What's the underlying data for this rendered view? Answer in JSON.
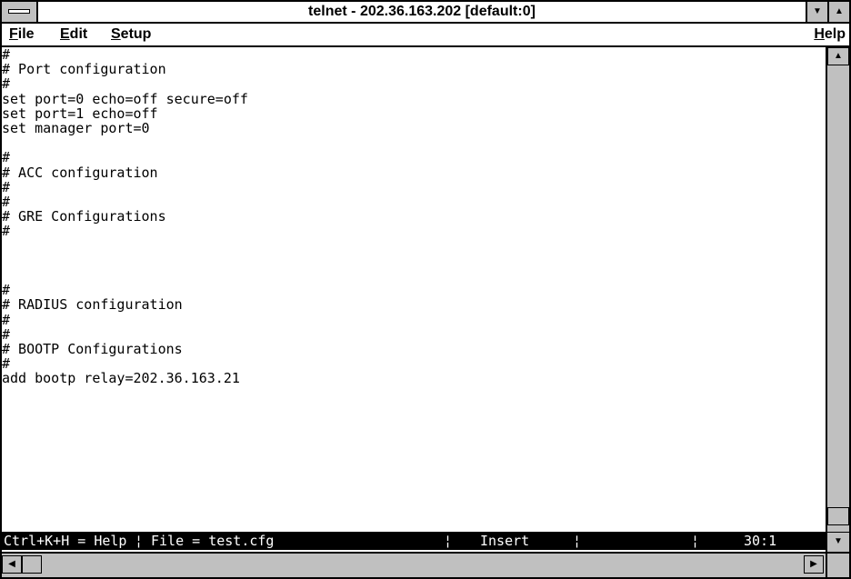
{
  "window": {
    "title": "telnet - 202.36.163.202 [default:0]",
    "system_menu_icon": "system-menu-icon",
    "minimize_icon": "▼",
    "maximize_icon": "▲"
  },
  "menubar": {
    "items": [
      {
        "label": "File",
        "accel": "F"
      },
      {
        "label": "Edit",
        "accel": "E"
      },
      {
        "label": "Setup",
        "accel": "S"
      },
      {
        "label": "Help",
        "accel": "H"
      }
    ]
  },
  "terminal": {
    "lines": [
      "#",
      "# Port configuration",
      "#",
      "set port=0 echo=off secure=off",
      "set port=1 echo=off",
      "set manager port=0",
      "",
      "#",
      "# ACC configuration",
      "#",
      "#",
      "# GRE Configurations",
      "#",
      "",
      "",
      "",
      "#",
      "# RADIUS configuration",
      "#",
      "#",
      "# BOOTP Configurations",
      "#",
      "add bootp relay=202.36.163.21",
      ""
    ]
  },
  "statusbar": {
    "help": "Ctrl+K+H = Help",
    "file": "File = test.cfg",
    "mode": "Insert",
    "position": "30:1",
    "separator": "¦"
  },
  "scrollbars": {
    "up_arrow": "▲",
    "down_arrow": "▼",
    "left_arrow": "◀",
    "right_arrow": "▶"
  }
}
